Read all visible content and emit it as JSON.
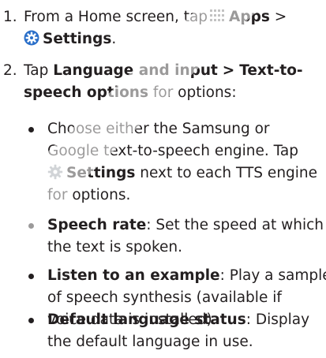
{
  "steps": [
    {
      "number": "1.",
      "line1_a": "From a Home screen, tap",
      "apps_label": "Apps",
      "gt": ">",
      "settings_label": "Settings",
      "period": "."
    },
    {
      "number": "2.",
      "line1_a": "Tap",
      "lang_label": "Language and input",
      "gt": ">",
      "tts_a": "Text-to-",
      "tts_b": "speech options",
      "for_options": "for options:"
    }
  ],
  "bullets": [
    {
      "l1": "Choose either the Samsung or",
      "l2": "Google text-to-speech engine. Tap",
      "settings_label": "Settings",
      "l3_rest": "next to each TTS engine",
      "l4": "for options."
    },
    {
      "bold": "Speech rate",
      "rest1": ": Set the speed at which",
      "l2": "the text is spoken."
    },
    {
      "bold": "Listen to an example",
      "rest1": ": Play a sample",
      "l2": "of speech synthesis (available if",
      "l3": "voice data is installed)."
    },
    {
      "bold": "Default language status",
      "rest1": ": Display",
      "l2": "the default language in use."
    }
  ],
  "colors": {
    "text": "#231f20",
    "settings_icon_blue": "#2a6fc9",
    "settings_icon_gray": "#9aa0a6",
    "watermark": "#d9d9d9"
  },
  "icons": [
    "apps-grid-icon",
    "settings-gear-icon",
    "settings-gear-gray-icon"
  ]
}
